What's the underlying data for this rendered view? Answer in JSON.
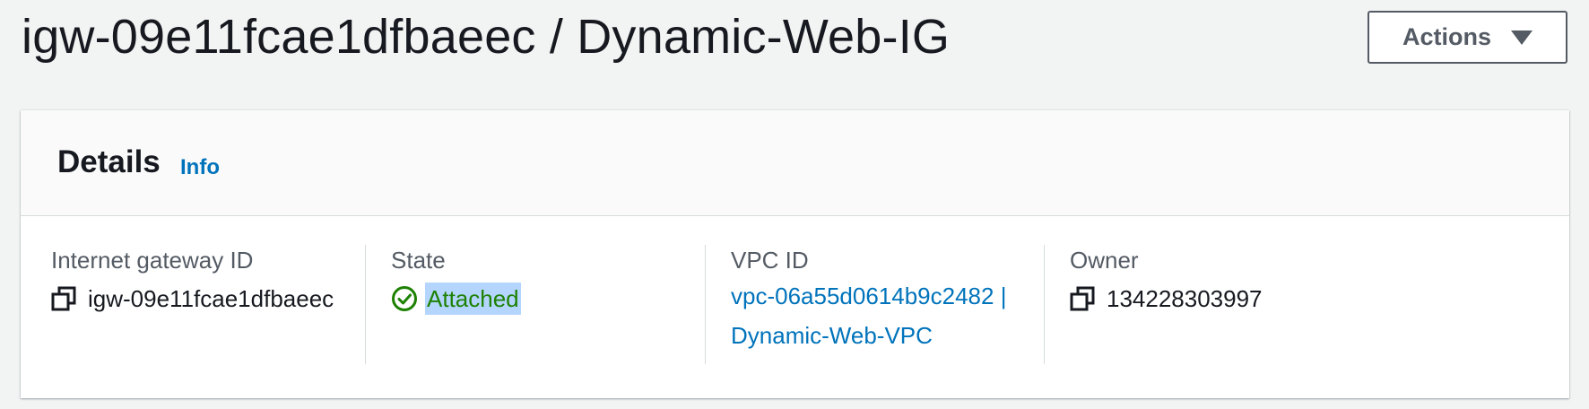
{
  "header": {
    "title": "igw-09e11fcae1dfbaeec / Dynamic-Web-IG",
    "actions_label": "Actions",
    "actions_icon": "caret-down-icon"
  },
  "details": {
    "title": "Details",
    "info_label": "Info",
    "fields": {
      "gateway_id": {
        "label": "Internet gateway ID",
        "value": "igw-09e11fcae1dfbaeec",
        "icon": "copy-icon"
      },
      "state": {
        "label": "State",
        "value": "Attached",
        "icon": "status-ok-icon",
        "color": "#1d8102"
      },
      "vpc": {
        "label": "VPC ID",
        "value_line1": "vpc-06a55d0614b9c2482 |",
        "value_line2": "Dynamic-Web-VPC"
      },
      "owner": {
        "label": "Owner",
        "value": "134228303997",
        "icon": "copy-icon"
      }
    }
  },
  "colors": {
    "link": "#0073bb",
    "success": "#1d8102",
    "background": "#f2f3f3",
    "selection": "#b4d5fe"
  }
}
